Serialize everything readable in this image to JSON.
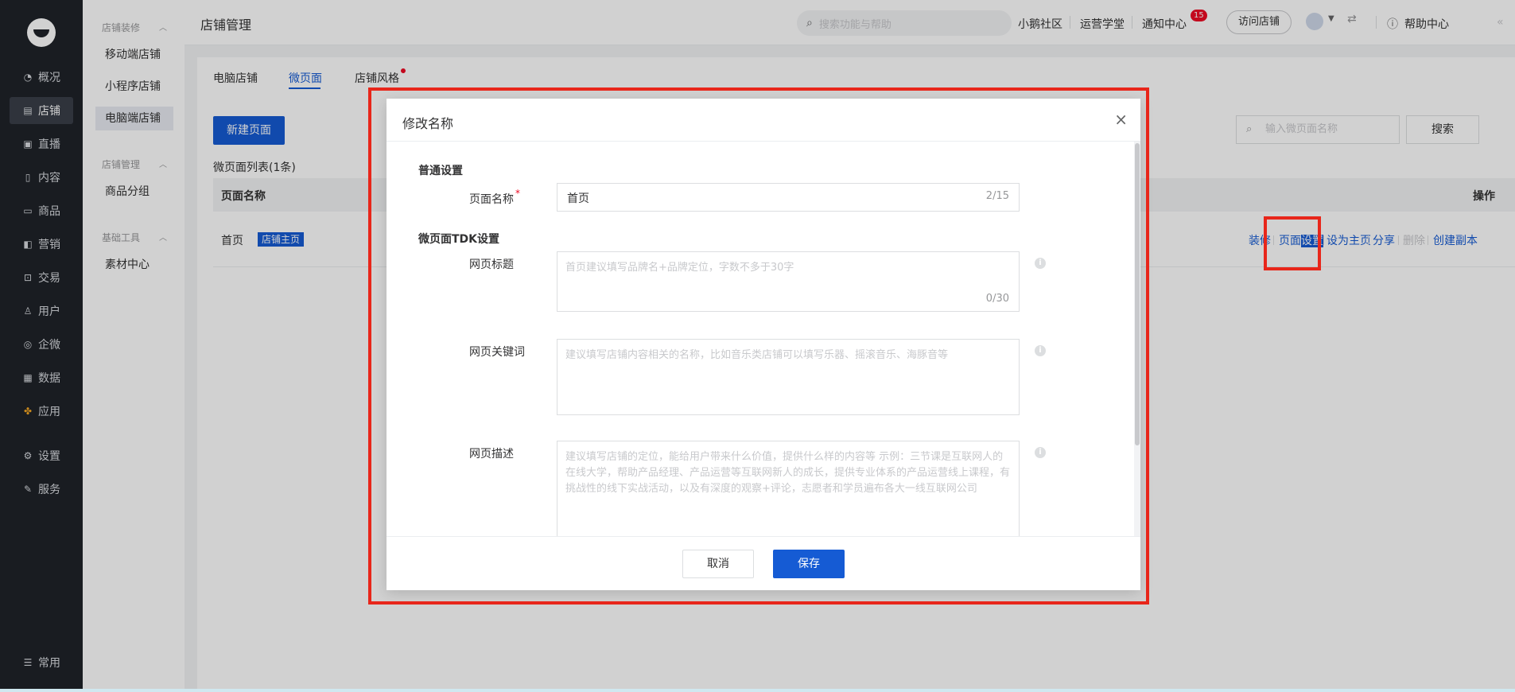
{
  "nav1": {
    "items": [
      {
        "label": "概况",
        "icon": "dashboard-icon"
      },
      {
        "label": "店铺",
        "icon": "store-icon"
      },
      {
        "label": "直播",
        "icon": "live-icon"
      },
      {
        "label": "内容",
        "icon": "content-icon"
      },
      {
        "label": "商品",
        "icon": "goods-icon"
      },
      {
        "label": "营销",
        "icon": "marketing-icon"
      },
      {
        "label": "交易",
        "icon": "trade-icon"
      },
      {
        "label": "用户",
        "icon": "user-icon"
      },
      {
        "label": "企微",
        "icon": "wecom-icon"
      },
      {
        "label": "数据",
        "icon": "data-icon"
      },
      {
        "label": "应用",
        "icon": "apps-icon"
      },
      {
        "label": "设置",
        "icon": "settings-icon"
      },
      {
        "label": "服务",
        "icon": "service-icon"
      }
    ],
    "bottom": "常用"
  },
  "nav2": {
    "group1": "店铺装修",
    "group1_items": [
      "移动端店铺",
      "小程序店铺",
      "电脑端店铺"
    ],
    "group2": "店铺管理",
    "group2_items": [
      "商品分组"
    ],
    "group3": "基础工具",
    "group3_items": [
      "素材中心"
    ]
  },
  "header": {
    "title": "店铺管理",
    "search_placeholder": "搜索功能与帮助",
    "links": [
      "小鹅社区",
      "运营学堂",
      "通知中心"
    ],
    "notification_count": "15",
    "visit": "访问店铺",
    "help": "帮助中心"
  },
  "tabs": [
    "电脑店铺",
    "微页面",
    "店铺风格"
  ],
  "list": {
    "new_button": "新建页面",
    "search_placeholder": "输入微页面名称",
    "search_button": "搜索",
    "title": "微页面列表(1条)",
    "col_name": "页面名称",
    "col_op": "操作",
    "row": {
      "name": "首页",
      "tag": "店铺主页"
    },
    "ops": {
      "decorate": "装修",
      "settings_a": "页面",
      "settings_b": "设置",
      "set_home": "设为主页",
      "share": "分享",
      "delete": "删除",
      "copy": "创建副本"
    }
  },
  "dialog": {
    "title": "修改名称",
    "section1": "普通设置",
    "name_label": "页面名称",
    "name_value": "首页",
    "name_count": "2/15",
    "section2": "微页面TDK设置",
    "title_label": "网页标题",
    "title_placeholder": "首页建议填写品牌名+品牌定位，字数不多于30字",
    "title_count": "0/30",
    "keywords_label": "网页关键词",
    "keywords_placeholder": "建议填写店铺内容相关的名称，比如音乐类店铺可以填写乐器、摇滚音乐、海豚音等",
    "desc_label": "网页描述",
    "desc_placeholder": "建议填写店铺的定位，能给用户带来什么价值，提供什么样的内容等 示例：三节课是互联网人的在线大学，帮助产品经理、产品运营等互联网新人的成长，提供专业体系的产品运营线上课程，有挑战性的线下实战活动，以及有深度的观察+评论，志愿者和学员遍布各大一线互联网公司",
    "cancel": "取消",
    "save": "保存"
  }
}
